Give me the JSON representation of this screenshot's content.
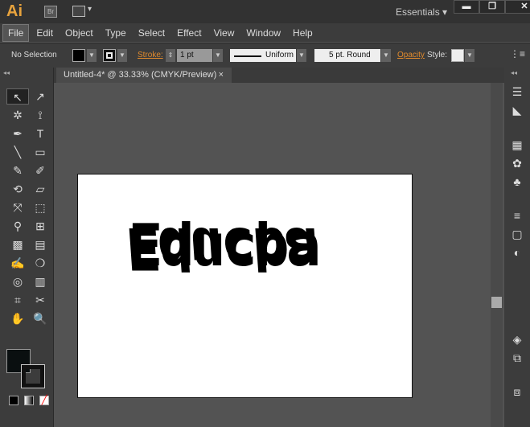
{
  "app": {
    "logo": "Ai",
    "bridge": "Br",
    "workspace": "Essentials",
    "window_buttons": [
      "▬",
      "❐",
      "✕"
    ]
  },
  "menu": [
    "File",
    "Edit",
    "Object",
    "Type",
    "Select",
    "Effect",
    "View",
    "Window",
    "Help"
  ],
  "control": {
    "selection": "No Selection",
    "stroke_label": "Stroke:",
    "stroke_value": "1 pt",
    "profile": "Uniform",
    "brush": "5 pt. Round",
    "opacity_label": "Opacity",
    "style_label": "Style:"
  },
  "document": {
    "tab": "Untitled-4* @ 33.33% (CMYK/Preview)",
    "close": "×"
  },
  "artwork": {
    "text": "Educba",
    "reflection": "Educba"
  },
  "tools": [
    "↖",
    "↗",
    "✲",
    "⟟",
    "✒",
    "T",
    "╲",
    "▭",
    "✎",
    "✐",
    "⟲",
    "▱",
    "⤧",
    "⬚",
    "⚲",
    "⊞",
    "▩",
    "▤",
    "✍",
    "❍",
    "◎",
    "▥",
    "⌗",
    "✂",
    "✋",
    "🔍"
  ],
  "right_panel": [
    "☰",
    "◣",
    "▦",
    "✿",
    "♣",
    "≡",
    "▢",
    "◐",
    "◈",
    "⧉",
    "⧈"
  ]
}
